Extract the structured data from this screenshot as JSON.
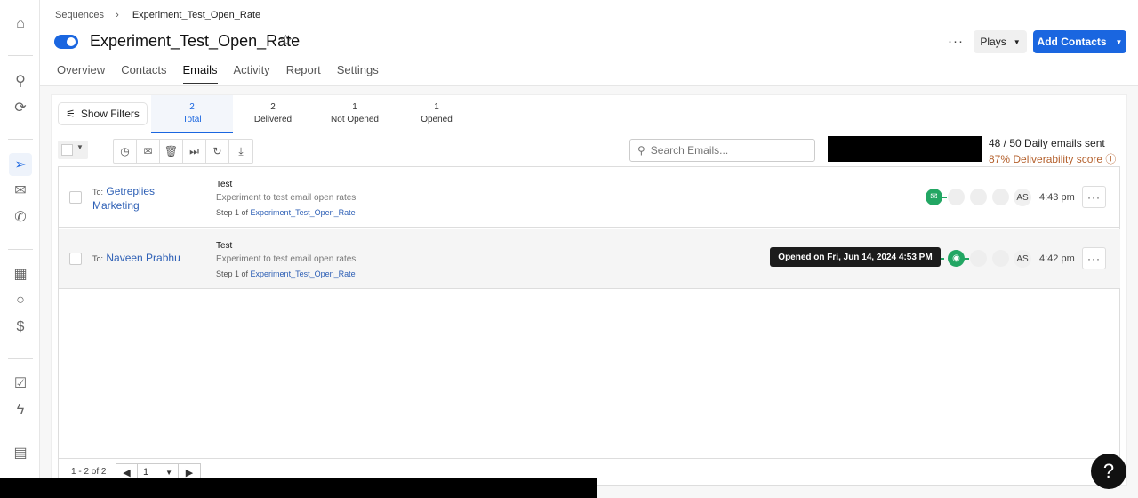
{
  "breadcrumb": {
    "parent": "Sequences",
    "current": "Experiment_Test_Open_Rate"
  },
  "header": {
    "title": "Experiment_Test_Open_Rate",
    "enabled": true,
    "plays_label": "Plays",
    "add_contacts_label": "Add Contacts"
  },
  "tabs": [
    {
      "label": "Overview"
    },
    {
      "label": "Contacts"
    },
    {
      "label": "Emails",
      "active": true
    },
    {
      "label": "Activity"
    },
    {
      "label": "Report"
    },
    {
      "label": "Settings"
    }
  ],
  "filters": {
    "show_filters_label": "Show Filters"
  },
  "stats": [
    {
      "count": "2",
      "label": "Total",
      "active": true
    },
    {
      "count": "2",
      "label": "Delivered"
    },
    {
      "count": "1",
      "label": "Not Opened"
    },
    {
      "count": "1",
      "label": "Opened"
    }
  ],
  "search": {
    "placeholder": "Search Emails..."
  },
  "quota": {
    "daily": "48 / 50 Daily emails sent",
    "deliverability": "87% Deliverability score"
  },
  "emails": [
    {
      "to_prefix": "To:",
      "recipient": "Getreplies Marketing",
      "subject": "Test",
      "preview": "Experiment to test email open rates",
      "step_prefix": "Step 1 of",
      "sequence": "Experiment_Test_Open_Rate",
      "owner": "AS",
      "time": "4:43 pm",
      "status": "delivered"
    },
    {
      "to_prefix": "To:",
      "recipient": "Naveen Prabhu",
      "subject": "Test",
      "preview": "Experiment to test email open rates",
      "step_prefix": "Step 1 of",
      "sequence": "Experiment_Test_Open_Rate",
      "owner": "AS",
      "time": "4:42 pm",
      "status": "opened"
    }
  ],
  "tooltip": "Opened on Fri, Jun 14, 2024 4:53 PM",
  "pagination": {
    "range": "1 - 2 of 2",
    "page": "1"
  },
  "colors": {
    "primary": "#1a66e0",
    "success": "#22a663",
    "warning": "#b4602c"
  }
}
